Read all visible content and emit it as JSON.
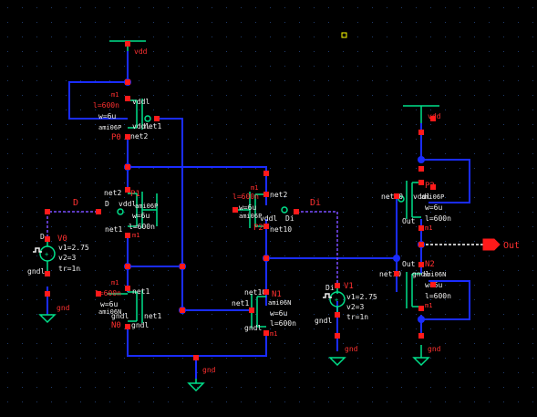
{
  "colors": {
    "background": "#000000",
    "grid": "#1f3a6a",
    "wire": "#1a2cff",
    "device": "#00e08a",
    "pin": "#ff1a1a",
    "label": "#ff3030",
    "text": "#f0f0f0",
    "dashed": "#7a4cff",
    "highlight": "#ffff00"
  },
  "supplies": {
    "vdd_left": "vdd",
    "vdd_right": "vdd",
    "gnd_bottom": "gnd",
    "gnd_right": "gnd",
    "gnd_v0": "gnd",
    "gnd_v1": "gnd"
  },
  "ports": {
    "d_left": "D",
    "di": "Di",
    "out_pin": "Out"
  },
  "devices": {
    "m1": {
      "inst": "m1",
      "l": "l=600n",
      "w": "w=6u",
      "model": "ami06P",
      "name": "P0",
      "pin_top": "vddl",
      "pin_side": "vddl",
      "net": "net1",
      "net_bottom": "net2"
    },
    "p1": {
      "name": "P1",
      "net_top": "net2",
      "pin_in": "D",
      "pin_bulk": "vddl",
      "model": "ami06P",
      "w": "w=6u",
      "l": "l=600n",
      "inst": "m1",
      "net_bottom": "net1"
    },
    "p2": {
      "inst": "m1",
      "l": "l=600n",
      "w": "w=6u",
      "model": "ami06P",
      "pin_bulk": "vddl",
      "pin_in": "Di",
      "name": "P2",
      "net_top": "net2",
      "net_bottom": "net10"
    },
    "p3": {
      "name": "P3",
      "pin_bulk": "vddl",
      "model": "ami06P",
      "w": "w=6u",
      "l": "l=600n",
      "inst": "m1",
      "net_in": "net10",
      "net_out": "Out"
    },
    "n0": {
      "inst": "m1",
      "l": "l=600n",
      "w": "w=6u",
      "model": "ami06N",
      "net_top": "net1",
      "net_side": "net1",
      "pin_bulk": "gndl",
      "name": "N0"
    },
    "n1": {
      "net_top": "net10",
      "net_in": "net1",
      "name": "N1",
      "model": "ami06N",
      "w": "w=6u",
      "l": "l=600n",
      "pin_bulk": "gndl",
      "inst": "m1"
    },
    "n2": {
      "net_out": "Out",
      "name": "N2",
      "net_in": "net10",
      "pin_bulk": "gndl",
      "model": "ami06N",
      "w": "w=6u",
      "l": "l=600n",
      "inst": "m1"
    }
  },
  "sources": {
    "v0": {
      "name": "V0",
      "pin_top": "D",
      "v1": "v1=2.75",
      "v2": "v2=3",
      "tr": "tr=1n",
      "pin_bottom": "gndl"
    },
    "v1": {
      "name": "V1",
      "pin_top": "Di",
      "v1": "v1=2.75",
      "v2": "v2=3",
      "tr": "tr=1n",
      "pin_bottom": "gndl"
    }
  }
}
